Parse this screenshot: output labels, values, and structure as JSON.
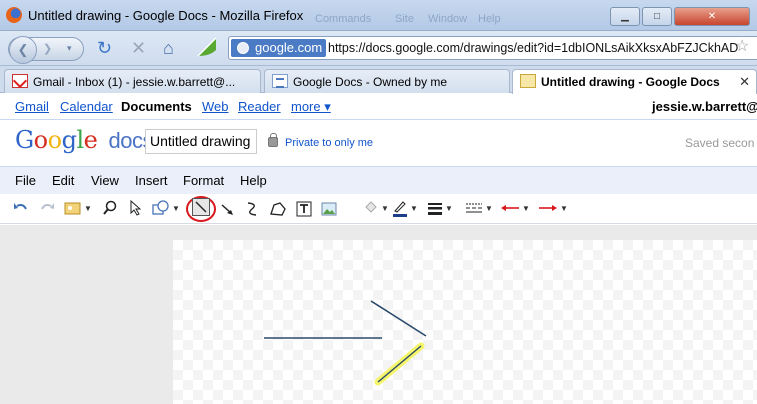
{
  "window": {
    "title": "Untitled drawing - Google Docs - Mozilla Firefox",
    "ghost_menus": [
      "Commands",
      "Site",
      "Window",
      "Help"
    ]
  },
  "navigation": {
    "site_identity": "google.com",
    "url": "https://docs.google.com/drawings/edit?id=1dbIONLsAikXksxAbFZJCkhAD"
  },
  "tabs": [
    {
      "label": "Gmail - Inbox (1) - jessie.w.barrett@...",
      "favicon": "gmail-icon",
      "active": false
    },
    {
      "label": "Google Docs - Owned by me",
      "favicon": "docs-icon",
      "active": false
    },
    {
      "label": "Untitled drawing - Google Docs",
      "favicon": "drawing-icon",
      "active": true
    }
  ],
  "gbar": {
    "links": [
      "Gmail",
      "Calendar",
      "Documents",
      "Web",
      "Reader",
      "more ▾"
    ],
    "current": "Documents",
    "email": "jessie.w.barrett@"
  },
  "header": {
    "logo_text": "Google",
    "logo_suffix": "docs",
    "doc_title": "Untitled drawing",
    "privacy": "Private to only me",
    "saved_status": "Saved secon"
  },
  "menu": [
    "File",
    "Edit",
    "View",
    "Insert",
    "Format",
    "Help"
  ],
  "toolbar": {
    "tools": [
      "undo-icon",
      "redo-icon",
      "image-frame-icon",
      "zoom-icon",
      "select-arrow-icon",
      "shape-icon",
      "line-icon",
      "arrow-icon",
      "curve-icon",
      "polyline-icon",
      "text-box-icon",
      "insert-image-icon",
      "fill-color-icon",
      "line-color-icon",
      "line-weight-icon",
      "line-dash-icon",
      "line-start-icon",
      "line-end-icon"
    ],
    "selected_tool": "line-icon",
    "highlight_color": "#d8181d"
  },
  "colors": {
    "link": "#1155cc",
    "menu_bg": "#ebeff9",
    "drawn_line": "#2b4a6b",
    "selection_highlight": "#f5f56a"
  }
}
